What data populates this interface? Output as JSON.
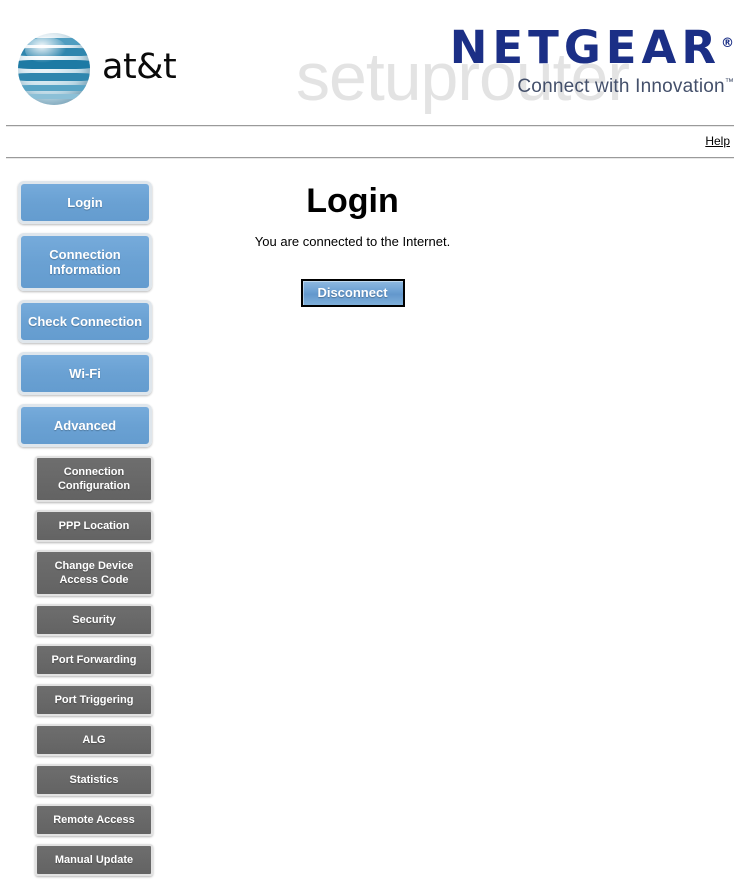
{
  "header": {
    "att_wordmark": "at&t",
    "watermark": "setuprouter",
    "netgear_name": "NETGEAR",
    "netgear_reg": "®",
    "netgear_tagline": "Connect with Innovation",
    "netgear_tm": "™"
  },
  "topbar": {
    "help_label": "Help"
  },
  "sidebar": {
    "main_items": [
      {
        "label": "Login",
        "active": true
      },
      {
        "label": "Connection Information",
        "active": false
      },
      {
        "label": "Check Connection",
        "active": false
      },
      {
        "label": "Wi-Fi",
        "active": false
      },
      {
        "label": "Advanced",
        "active": false
      }
    ],
    "sub_items": [
      {
        "label": "Connection Configuration"
      },
      {
        "label": "PPP Location"
      },
      {
        "label": "Change Device Access Code"
      },
      {
        "label": "Security"
      },
      {
        "label": "Port Forwarding"
      },
      {
        "label": "Port Triggering"
      },
      {
        "label": "ALG"
      },
      {
        "label": "Statistics"
      },
      {
        "label": "Remote Access"
      },
      {
        "label": "Manual Update"
      }
    ]
  },
  "main": {
    "title": "Login",
    "status_text": "You are connected to the Internet.",
    "disconnect_label": "Disconnect"
  },
  "colors": {
    "nav_blue": "#6ba3d6",
    "nav_gray": "#666666",
    "netgear_blue": "#1b2f86",
    "att_blue": "#2b7fa8",
    "watermark_gray": "#e3e3e3"
  }
}
